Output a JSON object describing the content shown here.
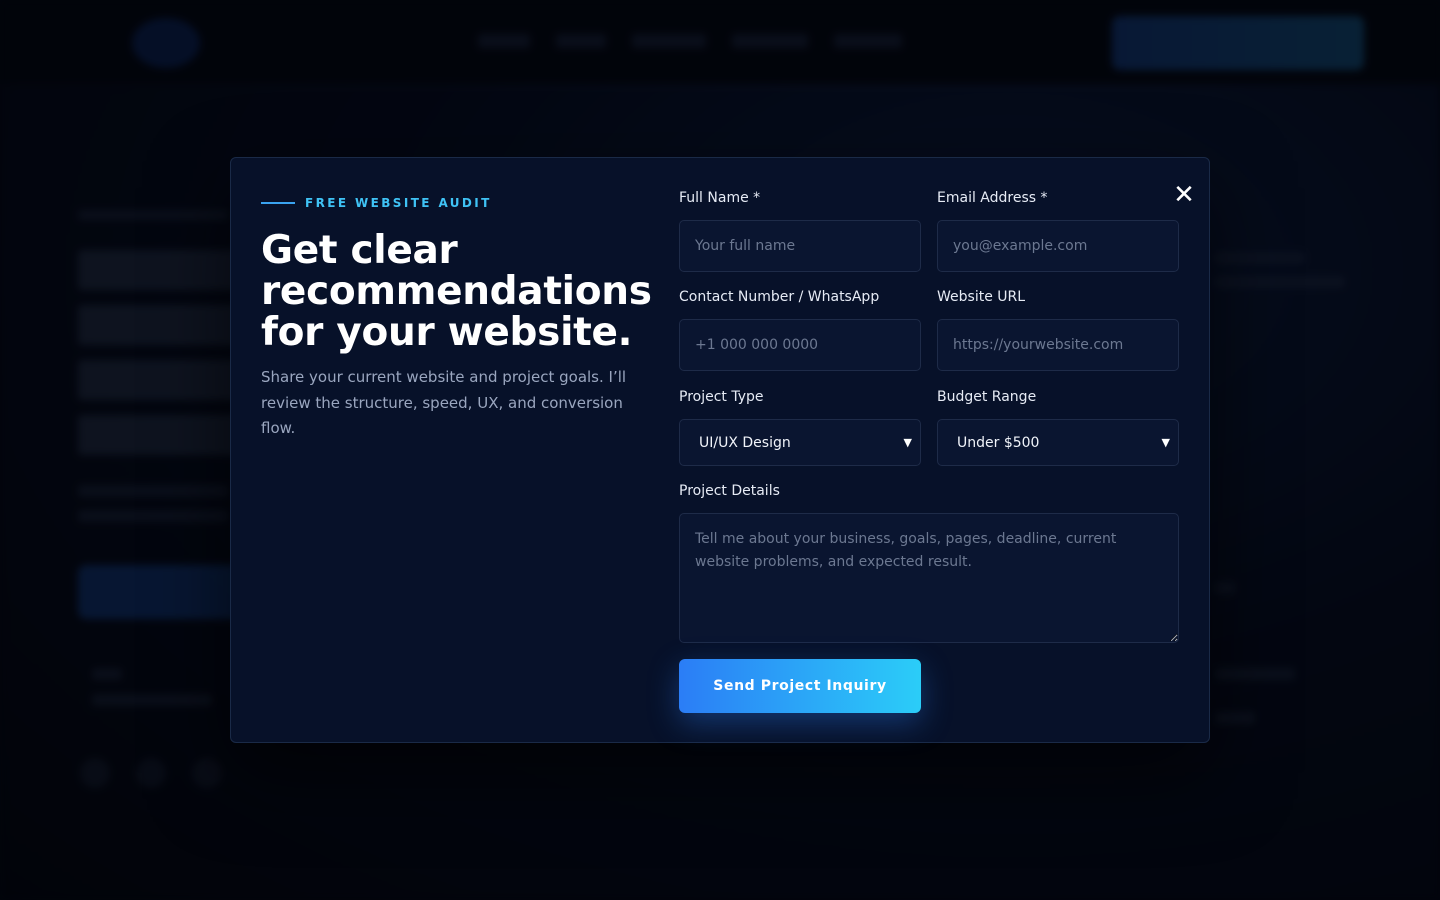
{
  "modal": {
    "close_icon": "close-icon",
    "eyebrow": "FREE WEBSITE AUDIT",
    "headline": "Get clear recommendations for your website.",
    "subtext": "Share your current website and project goals. I’ll review the structure, speed, UX, and conversion flow."
  },
  "form": {
    "full_name": {
      "label": "Full Name *",
      "placeholder": "Your full name",
      "value": ""
    },
    "email": {
      "label": "Email Address *",
      "placeholder": "you@example.com",
      "value": ""
    },
    "contact": {
      "label": "Contact Number / WhatsApp",
      "placeholder": "+1 000 000 0000",
      "value": ""
    },
    "website": {
      "label": "Website URL",
      "placeholder": "https://yourwebsite.com",
      "value": ""
    },
    "project_type": {
      "label": "Project Type",
      "selected": "UI/UX Design"
    },
    "budget": {
      "label": "Budget Range",
      "selected": "Under $500"
    },
    "details": {
      "label": "Project Details",
      "placeholder": "Tell me about your business, goals, pages, deadline, current website problems, and expected result.",
      "value": ""
    },
    "submit_label": "Send Project Inquiry"
  },
  "colors": {
    "modal_bg": "#071129",
    "accent": "#3fc3f5",
    "button_start": "#2b7df6",
    "button_end": "#2bcdf8"
  }
}
